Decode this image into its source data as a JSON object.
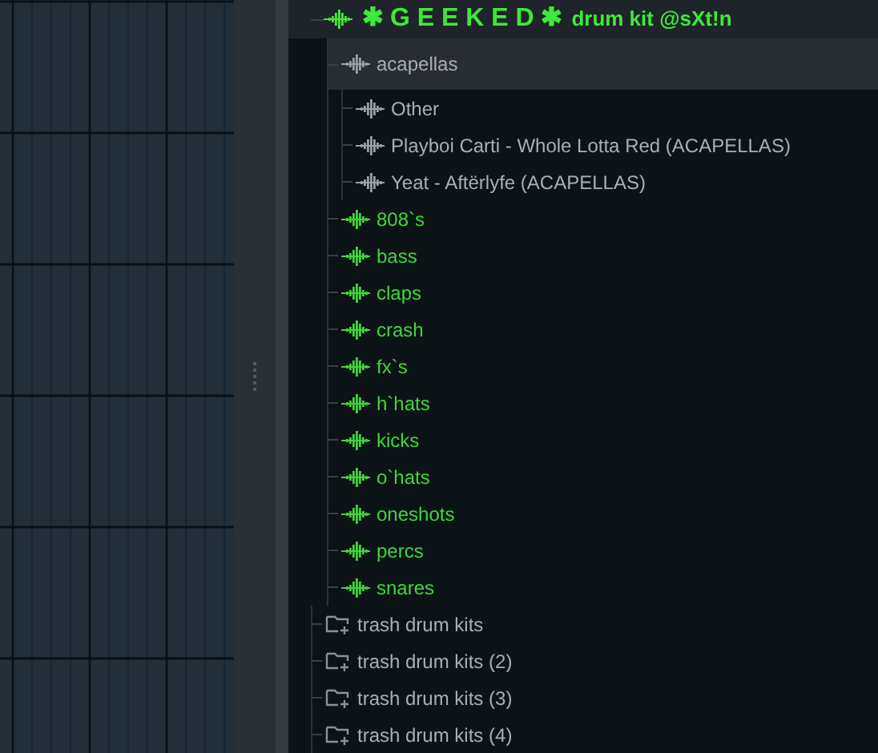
{
  "browser": {
    "root": {
      "title_mark": "✱ G E E K E D ✱",
      "title": "drum kit @sXt!n",
      "children": [
        {
          "label": "acapellas",
          "kind": "waveform",
          "highlighted": false,
          "selected": true,
          "children": [
            {
              "label": "Other",
              "kind": "waveform",
              "highlighted": false,
              "selected": false
            },
            {
              "label": "Playboi Carti - Whole Lotta Red (ACAPELLAS)",
              "kind": "waveform",
              "highlighted": false,
              "selected": false
            },
            {
              "label": "Yeat - Aftërlyfe (ACAPELLAS)",
              "kind": "waveform",
              "highlighted": false,
              "selected": false
            }
          ]
        },
        {
          "label": "808`s",
          "kind": "waveform",
          "highlighted": true,
          "selected": false
        },
        {
          "label": "bass",
          "kind": "waveform",
          "highlighted": true,
          "selected": false
        },
        {
          "label": "claps",
          "kind": "waveform",
          "highlighted": true,
          "selected": false
        },
        {
          "label": "crash",
          "kind": "waveform",
          "highlighted": true,
          "selected": false
        },
        {
          "label": "fx`s",
          "kind": "waveform",
          "highlighted": true,
          "selected": false
        },
        {
          "label": "h`hats",
          "kind": "waveform",
          "highlighted": true,
          "selected": false
        },
        {
          "label": "kicks",
          "kind": "waveform",
          "highlighted": true,
          "selected": false
        },
        {
          "label": "o`hats",
          "kind": "waveform",
          "highlighted": true,
          "selected": false
        },
        {
          "label": "oneshots",
          "kind": "waveform",
          "highlighted": true,
          "selected": false
        },
        {
          "label": "percs",
          "kind": "waveform",
          "highlighted": true,
          "selected": false
        },
        {
          "label": "snares",
          "kind": "waveform",
          "highlighted": true,
          "selected": false
        }
      ]
    },
    "items": [
      {
        "label": "trash drum kits",
        "kind": "folder",
        "highlighted": false,
        "selected": false
      },
      {
        "label": "trash drum kits (2)",
        "kind": "folder",
        "highlighted": false,
        "selected": false
      },
      {
        "label": "trash drum kits (3)",
        "kind": "folder",
        "highlighted": false,
        "selected": false
      },
      {
        "label": "trash drum kits (4)",
        "kind": "folder",
        "highlighted": false,
        "selected": false
      }
    ]
  }
}
